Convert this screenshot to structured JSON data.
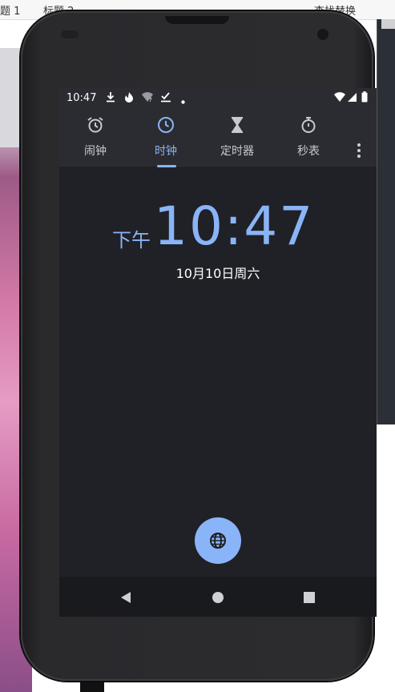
{
  "desktop": {
    "topbar_items": [
      "题 1",
      "标题 2",
      "查找替换"
    ],
    "colors": {
      "wallpaper": "#d47aa8"
    }
  },
  "statusbar": {
    "time": "10:47",
    "icons": [
      "download-icon",
      "flame-icon",
      "wifi-question-icon",
      "checkmark-icon",
      "dot-icon",
      "wifi-icon",
      "signal-icon",
      "battery-icon"
    ]
  },
  "tabs": [
    {
      "label": "闹钟",
      "icon": "alarm-icon",
      "active": false
    },
    {
      "label": "时钟",
      "icon": "clock-icon",
      "active": true
    },
    {
      "label": "定时器",
      "icon": "hourglass-icon",
      "active": false
    },
    {
      "label": "秒表",
      "icon": "stopwatch-icon",
      "active": false
    }
  ],
  "clock": {
    "ampm": "下午",
    "time": "10:47",
    "date": "10月10日周六"
  },
  "fab": {
    "icon": "globe-icon"
  },
  "navbar": {
    "buttons": [
      "back-icon",
      "home-icon",
      "recents-icon"
    ]
  },
  "colors": {
    "accent": "#8ab4f8",
    "background": "#202126",
    "toolbar": "#2b2c31"
  }
}
